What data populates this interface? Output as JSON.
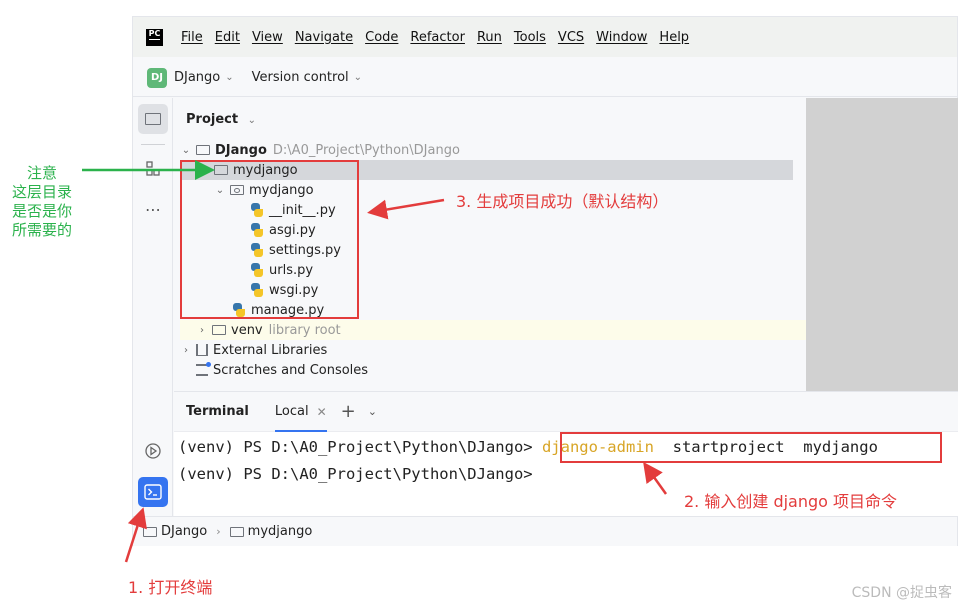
{
  "menu": {
    "logo": "PC",
    "items": [
      "File",
      "Edit",
      "View",
      "Navigate",
      "Code",
      "Refactor",
      "Run",
      "Tools",
      "VCS",
      "Window",
      "Help"
    ]
  },
  "project_bar": {
    "badge": "DJ",
    "name": "DJango",
    "version_control": "Version control"
  },
  "project_panel": {
    "title": "Project",
    "root_name": "DJango",
    "root_path": "D:\\A0_Project\\Python\\DJango",
    "tree": [
      {
        "label": "mydjango"
      },
      {
        "label": "mydjango"
      },
      {
        "label": "__init__.py"
      },
      {
        "label": "asgi.py"
      },
      {
        "label": "settings.py"
      },
      {
        "label": "urls.py"
      },
      {
        "label": "wsgi.py"
      },
      {
        "label": "manage.py"
      },
      {
        "label": "venv",
        "hint": "library root"
      },
      {
        "label": "External Libraries"
      },
      {
        "label": "Scratches and Consoles"
      }
    ]
  },
  "terminal": {
    "title": "Terminal",
    "tab": "Local",
    "line1_prompt": "(venv) PS D:\\A0_Project\\Python\\DJango>",
    "line1_cmd_a": "django-admin",
    "line1_cmd_b": "startproject  mydjango",
    "line2_prompt": "(venv) PS D:\\A0_Project\\Python\\DJango>"
  },
  "breadcrumb": [
    "DJango",
    "mydjango"
  ],
  "annotations": {
    "green_note": [
      "注意",
      "这层目录",
      "是否是你",
      "所需要的"
    ],
    "step1": "1. 打开终端",
    "step2": "2. 输入创建 django 项目命令",
    "step3": "3. 生成项目成功（默认结构）"
  },
  "watermark": "CSDN @捉虫客",
  "colors": {
    "annotation_red": "#e33c3c",
    "annotation_green": "#2bb24c",
    "accent_blue": "#3574f0",
    "command_highlight": "#d8a526"
  }
}
